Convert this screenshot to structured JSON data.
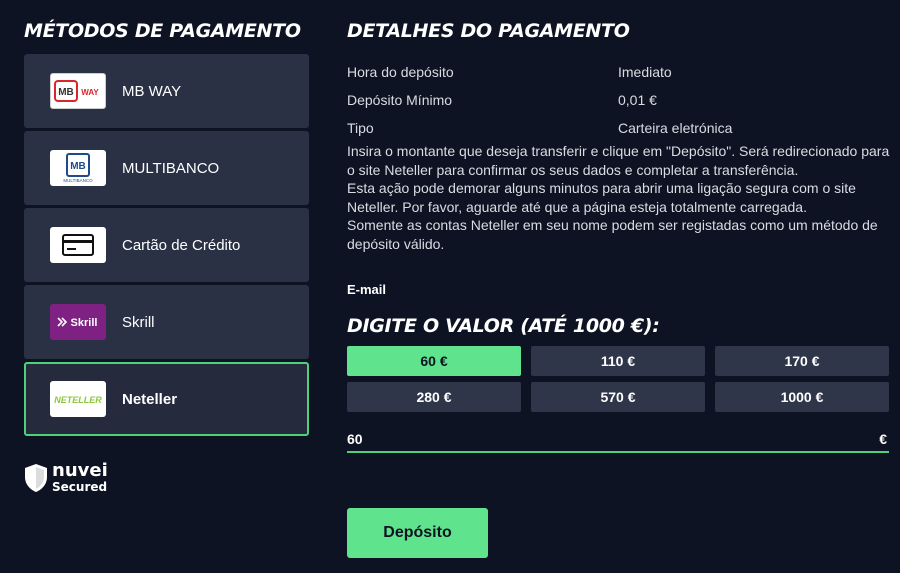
{
  "left_heading": "MÉTODOS DE PAGAMENTO",
  "right_heading": "DETALHES DO PAGAMENTO",
  "methods": [
    {
      "label": "MB WAY",
      "logo_text": "MB",
      "logo_sub": "WAY"
    },
    {
      "label": "MULTIBANCO",
      "logo_text": "MB",
      "logo_sub": "MULTIBANCO"
    },
    {
      "label": "Cartão de Crédito"
    },
    {
      "label": "Skrill",
      "logo_text": "Skrill"
    },
    {
      "label": "Neteller",
      "logo_text": "NETELLER"
    }
  ],
  "details": [
    {
      "key": "Hora do depósito",
      "value": "Imediato"
    },
    {
      "key": "Depósito Mínimo",
      "value": "0,01 €"
    },
    {
      "key": "Tipo",
      "value": "Carteira eletrónica"
    }
  ],
  "description": [
    "Insira o montante que deseja transferir e clique em \"Depósito\". Será redirecionado para o site Neteller para confirmar os seus dados e completar a transferência.",
    "Esta ação pode demorar alguns minutos para abrir uma ligação segura com o site Neteller. Por favor, aguarde até que a página esteja totalmente carregada.",
    "Somente as contas Neteller em seu nome podem ser registadas como um método de depósito válido."
  ],
  "email_label": "E-mail",
  "value_heading": "DIGITE O VALOR (ATÉ 1000 €):",
  "amounts": [
    "60 €",
    "110 €",
    "170 €",
    "280 €",
    "570 €",
    "1000 €"
  ],
  "selected_amount_index": 0,
  "amount_input_value": "60",
  "currency_symbol": "€",
  "deposit_button": "Depósito",
  "nuvei": {
    "name": "nuvei",
    "sub": "Secured"
  },
  "colors": {
    "accent": "#5fe38c",
    "background": "#0d1322",
    "card": "#2a3145",
    "skrill": "#7f2182",
    "neteller": "#8dc63f",
    "mb_red": "#d8262b"
  }
}
